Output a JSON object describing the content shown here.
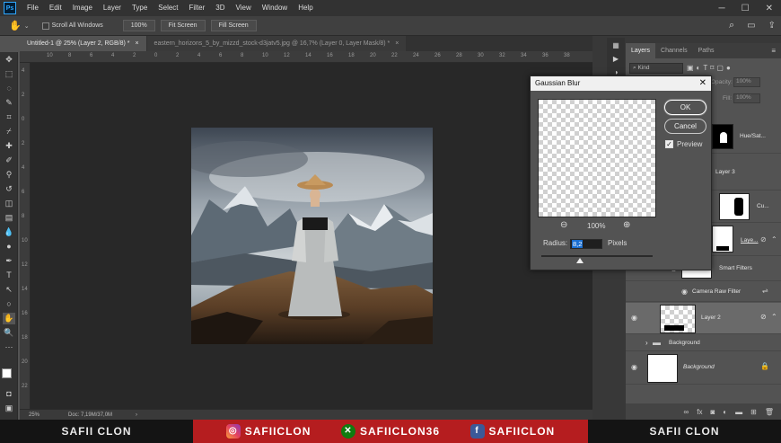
{
  "menubar": {
    "items": [
      "File",
      "Edit",
      "Image",
      "Layer",
      "Type",
      "Select",
      "Filter",
      "3D",
      "View",
      "Window",
      "Help"
    ]
  },
  "options": {
    "scroll_all_windows": "Scroll All Windows",
    "zoom": "100%",
    "fit_screen": "Fit Screen",
    "fill_screen": "Fill Screen"
  },
  "tabs": [
    {
      "label": "Untitled-1 @ 25% (Layer 2, RGB/8) *"
    },
    {
      "label": "eastern_horizons_5_by_mizzd_stock-d3jatv5.jpg @ 16,7% (Layer 0, Layer Mask/8) *"
    }
  ],
  "rulers": {
    "h": [
      "10",
      "8",
      "6",
      "4",
      "2",
      "0",
      "2",
      "4",
      "6",
      "8",
      "10",
      "12",
      "14",
      "16",
      "18",
      "20",
      "22",
      "24",
      "26",
      "28",
      "30",
      "32",
      "34",
      "36",
      "38"
    ],
    "v": [
      "4",
      "2",
      "0",
      "2",
      "4",
      "6",
      "8",
      "10",
      "12",
      "14",
      "16",
      "18",
      "20",
      "22"
    ]
  },
  "status": {
    "zoom": "25%",
    "doc": "Doc: 7,19M/37,0M"
  },
  "panel": {
    "tabs": [
      "Layers",
      "Channels",
      "Paths"
    ],
    "kind": "Kind",
    "opacity_label": "Opacity:",
    "opacity": "100%",
    "fill_label": "Fill:",
    "fill": "100%"
  },
  "layers": [
    {
      "name": "Hue/Sat..."
    },
    {
      "name": "Layer 3"
    },
    {
      "name": "Cu..."
    },
    {
      "name": "Laye..."
    },
    {
      "name": "Smart Filters"
    },
    {
      "name": "Camera Raw Filter"
    },
    {
      "name": "Layer 2"
    },
    {
      "name": "Background"
    },
    {
      "name": "Background"
    }
  ],
  "dialog": {
    "title": "Gaussian Blur",
    "ok": "OK",
    "cancel": "Cancel",
    "preview": "Preview",
    "zoom": "100%",
    "radius_label": "Radius:",
    "radius_value": "8,2",
    "unit": "Pixels"
  },
  "banner": {
    "left": "SAFII CLON",
    "instagram": "SAFIICLON",
    "xbox": "SAFIICLON36",
    "facebook": "SAFIICLON",
    "right": "SAFII CLON"
  },
  "colors": {
    "accent": "#1a6fd1",
    "banner_red": "#b51d1f",
    "ps_blue": "#31a8ff"
  }
}
